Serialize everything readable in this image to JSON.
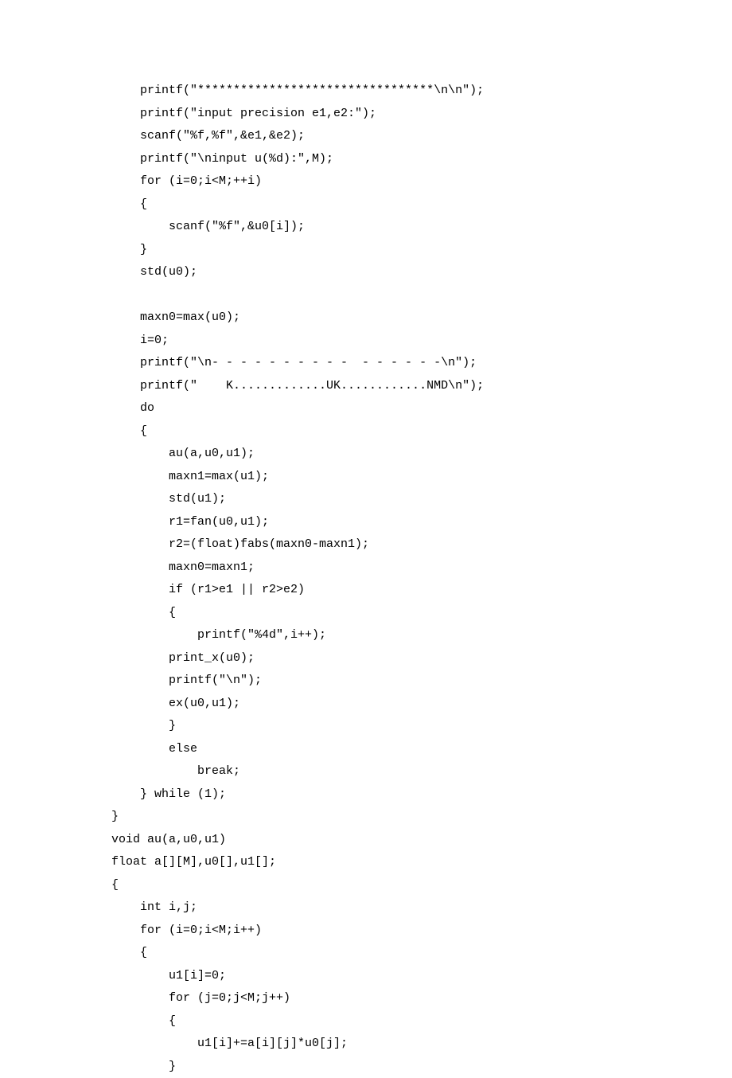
{
  "code_lines": [
    "    printf(\"*********************************\\n\\n\");",
    "    printf(\"input precision e1,e2:\");",
    "    scanf(\"%f,%f\",&e1,&e2);",
    "    printf(\"\\ninput u(%d):\",M);",
    "    for (i=0;i<M;++i)",
    "    {",
    "        scanf(\"%f\",&u0[i]);",
    "    }",
    "    std(u0);",
    "",
    "    maxn0=max(u0);",
    "    i=0;",
    "    printf(\"\\n- - - - - - - - - -  - - - - - -\\n\");",
    "    printf(\"    K.............UK............NMD\\n\");",
    "    do",
    "    {",
    "        au(a,u0,u1);",
    "        maxn1=max(u1);",
    "        std(u1);",
    "        r1=fan(u0,u1);",
    "        r2=(float)fabs(maxn0-maxn1);",
    "        maxn0=maxn1;",
    "        if (r1>e1 || r2>e2)",
    "        {",
    "            printf(\"%4d\",i++);",
    "        print_x(u0);",
    "        printf(\"\\n\");",
    "        ex(u0,u1);",
    "        }",
    "        else",
    "            break;",
    "    } while (1);",
    "}",
    "void au(a,u0,u1)",
    "float a[][M],u0[],u1[];",
    "{",
    "    int i,j;",
    "    for (i=0;i<M;i++)",
    "    {",
    "        u1[i]=0;",
    "        for (j=0;j<M;j++)",
    "        {",
    "            u1[i]+=a[i][j]*u0[j];",
    "        }"
  ]
}
